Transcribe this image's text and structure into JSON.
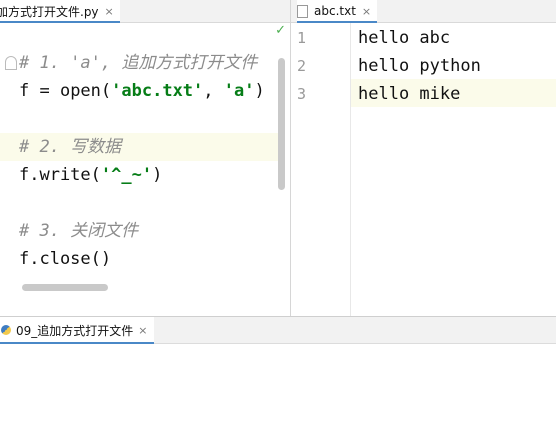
{
  "left_editor": {
    "tab_label": "加方式打开文件.py",
    "tab_close": "×",
    "check_mark": "✓",
    "lines": [
      {
        "parts": [
          {
            "t": "# 1. 'a', 追加方式打开文件",
            "c": "comment"
          }
        ]
      },
      {
        "parts": [
          {
            "t": "f = ",
            "c": "plain"
          },
          {
            "t": "open",
            "c": "plain"
          },
          {
            "t": "(",
            "c": "plain"
          },
          {
            "t": "'abc.txt'",
            "c": "str"
          },
          {
            "t": ", ",
            "c": "plain"
          },
          {
            "t": "'a'",
            "c": "str"
          },
          {
            "t": ")",
            "c": "plain"
          }
        ]
      },
      {
        "parts": []
      },
      {
        "parts": [
          {
            "t": "# 2. 写数据",
            "c": "comment"
          }
        ]
      },
      {
        "parts": [
          {
            "t": "f.write(",
            "c": "plain"
          },
          {
            "t": "'^_~'",
            "c": "str"
          },
          {
            "t": ")",
            "c": "plain"
          }
        ]
      },
      {
        "parts": []
      },
      {
        "parts": [
          {
            "t": "# 3. 关闭文件",
            "c": "comment"
          }
        ]
      },
      {
        "parts": [
          {
            "t": "f.close()",
            "c": "plain"
          }
        ]
      }
    ]
  },
  "right_editor": {
    "tab_label": "abc.txt",
    "tab_close": "×",
    "line_numbers": [
      "1",
      "2",
      "3"
    ],
    "lines": [
      "hello abc",
      "hello python",
      "hello mike"
    ]
  },
  "run_panel": {
    "tab_label": "09_追加方式打开文件",
    "tab_close": "×"
  }
}
